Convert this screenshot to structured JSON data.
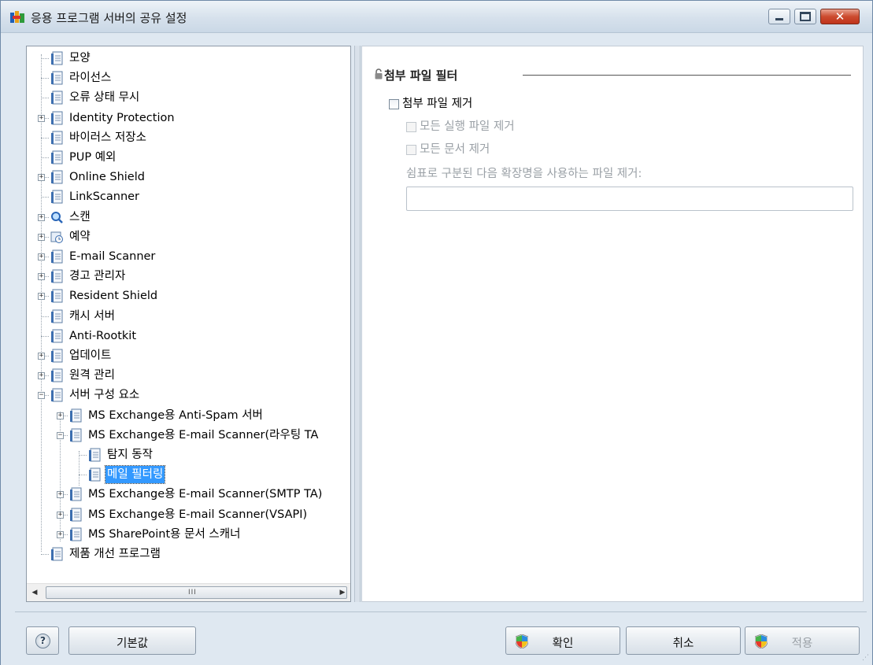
{
  "window": {
    "title": "응용 프로그램 서버의 공유 설정",
    "close_glyph": "✕"
  },
  "tree": {
    "items": [
      {
        "label": "모양"
      },
      {
        "label": "라이선스"
      },
      {
        "label": "오류 상태 무시"
      },
      {
        "label": "Identity Protection"
      },
      {
        "label": "바이러스 저장소"
      },
      {
        "label": "PUP 예외"
      },
      {
        "label": "Online Shield"
      },
      {
        "label": "LinkScanner"
      },
      {
        "label": "스캔"
      },
      {
        "label": "예약"
      },
      {
        "label": "E-mail Scanner"
      },
      {
        "label": "경고 관리자"
      },
      {
        "label": "Resident Shield"
      },
      {
        "label": "캐시 서버"
      },
      {
        "label": "Anti-Rootkit"
      },
      {
        "label": "업데이트"
      },
      {
        "label": "원격 관리"
      },
      {
        "label": "서버 구성 요소"
      },
      {
        "label": "MS Exchange용 Anti-Spam 서버"
      },
      {
        "label": "MS Exchange용 E-mail Scanner(라우팅 TA"
      },
      {
        "label": "탐지 동작"
      },
      {
        "label": "메일 필터링"
      },
      {
        "label": "MS Exchange용 E-mail Scanner(SMTP TA)"
      },
      {
        "label": "MS Exchange용 E-mail Scanner(VSAPI)"
      },
      {
        "label": "MS SharePoint용 문서 스캐너"
      },
      {
        "label": "제품 개선 프로그램"
      }
    ],
    "scroll_grip": "III"
  },
  "content": {
    "section_title": "첨부 파일 필터",
    "remove_attachments_label": "첨부 파일 제거",
    "remove_executables_label": "모든 실행 파일 제거",
    "remove_documents_label": "모든 문서 제거",
    "extensions_label": "쉼표로 구분된 다음 확장명을 사용하는 파일 제거:",
    "extensions_value": ""
  },
  "buttons": {
    "help": "?",
    "defaults": "기본값",
    "ok": "확인",
    "cancel": "취소",
    "apply": "적용"
  },
  "colors": {
    "selection": "#3399ff",
    "window_bg": "#dfe8f1"
  }
}
